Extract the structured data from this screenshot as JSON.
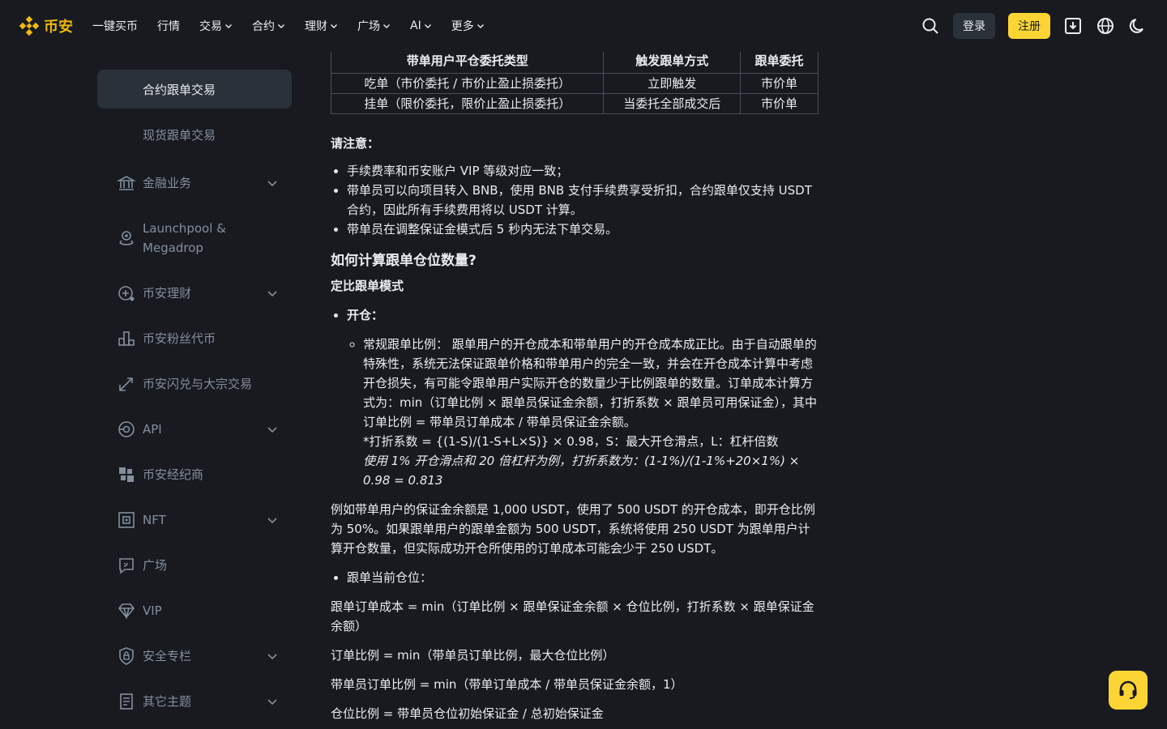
{
  "header": {
    "logo_text": "币安",
    "nav": [
      {
        "label": "一键买币",
        "has_menu": false
      },
      {
        "label": "行情",
        "has_menu": false
      },
      {
        "label": "交易",
        "has_menu": true
      },
      {
        "label": "合约",
        "has_menu": true
      },
      {
        "label": "理财",
        "has_menu": true
      },
      {
        "label": "广场",
        "has_menu": true
      },
      {
        "label": "AI",
        "has_menu": true
      },
      {
        "label": "更多",
        "has_menu": true
      }
    ],
    "login_label": "登录",
    "register_label": "注册"
  },
  "sidebar": {
    "sub_items": [
      "合约跟单交易",
      "现货跟单交易"
    ],
    "items": [
      {
        "label": "金融业务",
        "icon": "bank-icon",
        "expandable": true
      },
      {
        "label": "Launchpool & Megadrop",
        "icon": "launchpool-icon",
        "expandable": false
      },
      {
        "label": "币安理财",
        "icon": "earn-icon",
        "expandable": true
      },
      {
        "label": "币安粉丝代币",
        "icon": "fan-token-icon",
        "expandable": false
      },
      {
        "label": "币安闪兑与大宗交易",
        "icon": "convert-icon",
        "expandable": false
      },
      {
        "label": "API",
        "icon": "api-icon",
        "expandable": true
      },
      {
        "label": "币安经纪商",
        "icon": "broker-icon",
        "expandable": false
      },
      {
        "label": "NFT",
        "icon": "nft-icon",
        "expandable": true
      },
      {
        "label": "广场",
        "icon": "square-icon",
        "expandable": false
      },
      {
        "label": "VIP",
        "icon": "vip-icon",
        "expandable": false
      },
      {
        "label": "安全专栏",
        "icon": "security-icon",
        "expandable": true
      },
      {
        "label": "其它主题",
        "icon": "document-icon",
        "expandable": true
      }
    ]
  },
  "main": {
    "table": {
      "headers": [
        "带单用户平仓委托类型",
        "触发跟单方式",
        "跟单委托"
      ],
      "rows": [
        [
          "吃单（市价委托 / 市价止盈止损委托）",
          "立即触发",
          "市价单"
        ],
        [
          "挂单（限价委托，限价止盈止损委托）",
          "当委托全部成交后",
          "市价单"
        ]
      ]
    },
    "note_title": "请注意：",
    "notes": [
      "手续费率和币安账户 VIP 等级对应一致；",
      "带单员可以向项目转入 BNB，使用 BNB 支付手续费享受折扣，合约跟单仅支持 USDT 合约，因此所有手续费用将以 USDT 计算。",
      "带单员在调整保证金模式后 5 秒内无法下单交易。"
    ],
    "section_title": "如何计算跟单仓位数量?",
    "mode_title": "定比跟单模式",
    "open_label": "开仓：",
    "open_detail": "常规跟单比例： 跟单用户的开仓成本和带单用户的开仓成本成正比。由于自动跟单的特殊性，系统无法保证跟单价格和带单用户的完全一致，并会在开仓成本计算中考虑开仓损失，有可能令跟单用户实际开仓的数量少于比例跟单的数量。订单成本计算方式为：min（订单比例 × 跟单员保证金余额，打折系数 × 跟单员可用保证金），其中订单比例 = 带单员订单成本 / 带单员保证金余额。",
    "discount_formula": "*打折系数 = {(1-S)/(1-S+L×S)} × 0.98，S：最大开仓滑点，L：杠杆倍数",
    "discount_example": "使用 1% 开仓滑点和 20 倍杠杆为例，打折系数为：(1-1%)/(1-1%+20×1%) × 0.98 = 0.813",
    "example_para": "例如带单用户的保证金余额是 1,000 USDT，使用了 500 USDT 的开仓成本，即开仓比例为 50%。如果跟单用户的跟单金额为 500 USDT，系统将使用 250 USDT 为跟单用户计算开仓数量，但实际成功开仓所使用的订单成本可能会少于 250 USDT。",
    "current_position_label": "跟单当前仓位：",
    "formula1": "跟单订单成本 = min（订单比例 × 跟单保证金余额 × 仓位比例，打折系数 × 跟单保证金余额）",
    "formula2": "订单比例 = min（带单员订单比例，最大仓位比例）",
    "formula3": "带单员订单比例 = min（带单订单成本 / 带单员保证金余额，1）",
    "formula4": "仓位比例 = 带单员仓位初始保证金 / 总初始保证金"
  },
  "colors": {
    "brand": "#f0b90b",
    "register_bg": "#fcd535",
    "background": "#181a20",
    "panel": "#2b3139",
    "muted_text": "#848e9c"
  }
}
